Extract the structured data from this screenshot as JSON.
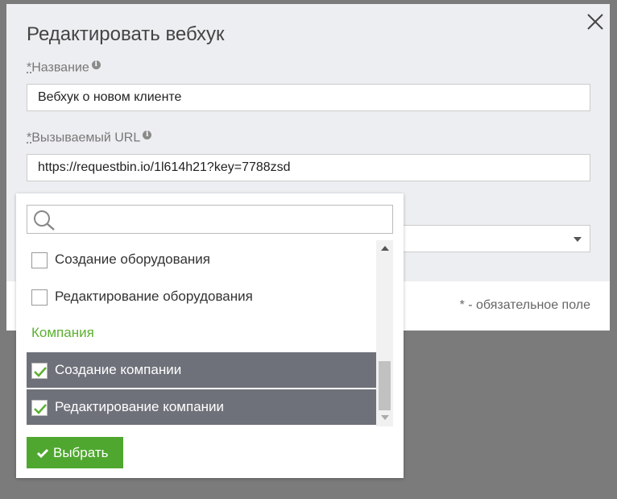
{
  "dialog": {
    "title": "Редактировать вебхук",
    "required_note": "* - обязательное поле",
    "fields": [
      {
        "required_mark": "*",
        "label": "Название",
        "value": "Вебхук о новом клиенте"
      },
      {
        "required_mark": "*",
        "label": "Вызываемый URL",
        "value": "https://requestbin.io/1l614h21?key=7788zsd"
      }
    ]
  },
  "dropdown": {
    "search_value": "",
    "items": [
      {
        "label": "Создание оборудования",
        "checked": false
      },
      {
        "label": "Редактирование оборудования",
        "checked": false
      }
    ],
    "group_label": "Компания",
    "group_items": [
      {
        "label": "Создание компании",
        "checked": true
      },
      {
        "label": "Редактирование компании",
        "checked": true
      }
    ],
    "submit_label": "Выбрать"
  },
  "colors": {
    "accent_green": "#4fa72f",
    "group_green": "#5cb031",
    "selected_row": "#6f717a",
    "overlay": "#7b7b7b"
  },
  "icons": [
    "close-icon",
    "info-icon",
    "search-icon",
    "checkmark-icon",
    "chevron-down-icon",
    "scroll-up-icon",
    "scroll-down-icon"
  ]
}
